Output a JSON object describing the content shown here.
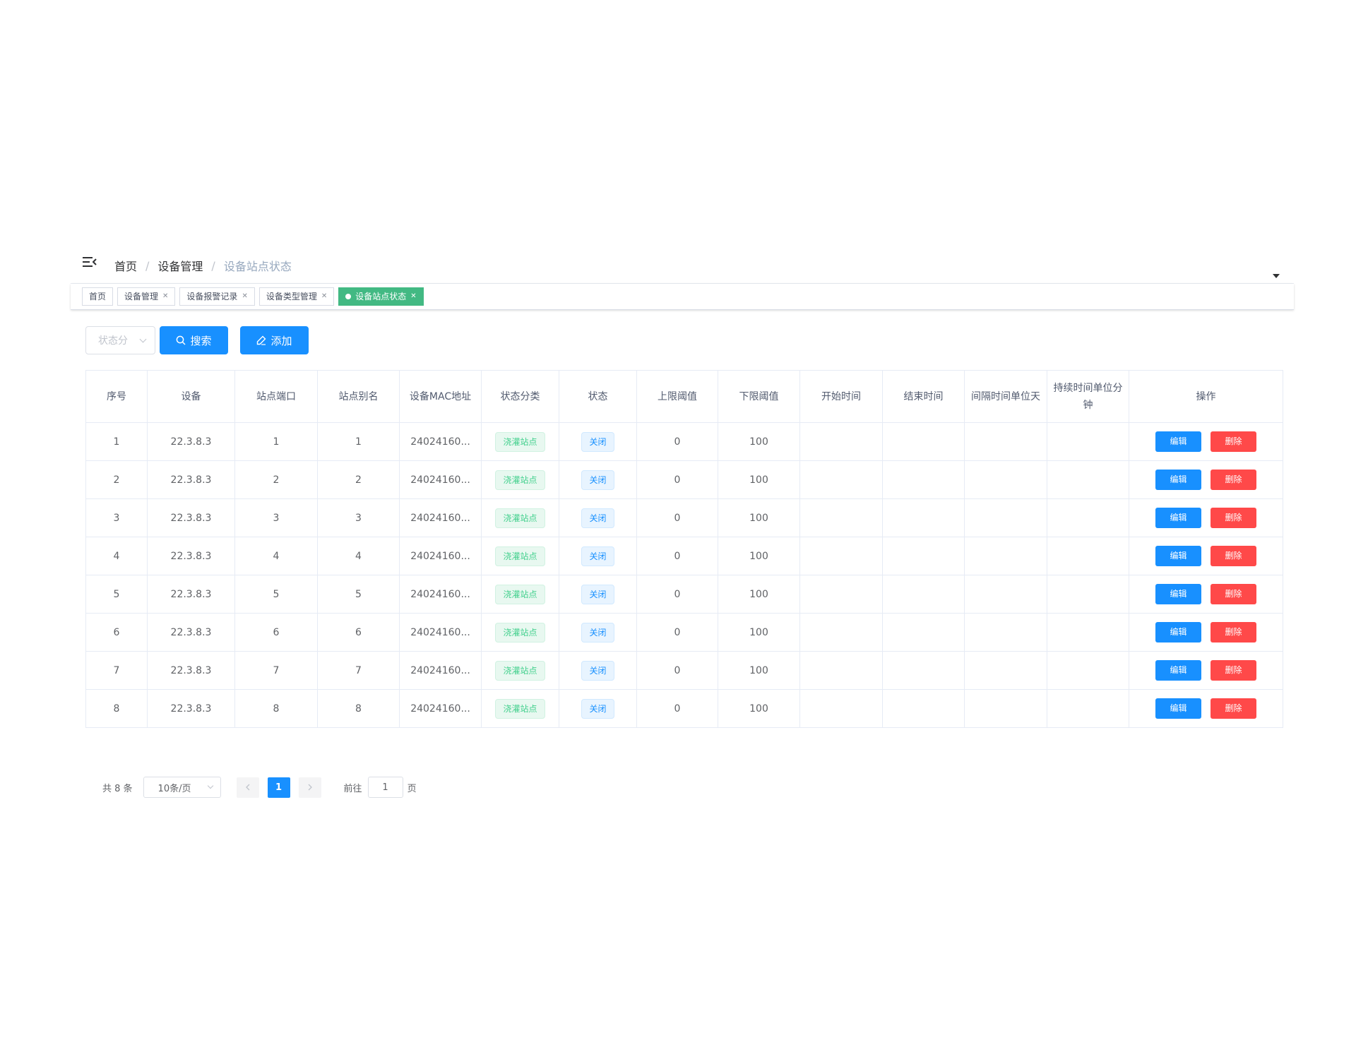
{
  "breadcrumb": [
    "首页",
    "设备管理",
    "设备站点状态"
  ],
  "tags": [
    {
      "label": "首页",
      "closable": false,
      "active": false
    },
    {
      "label": "设备管理",
      "closable": true,
      "active": false
    },
    {
      "label": "设备报警记录",
      "closable": true,
      "active": false
    },
    {
      "label": "设备类型管理",
      "closable": true,
      "active": false
    },
    {
      "label": "设备站点状态",
      "closable": true,
      "active": true
    }
  ],
  "toolbar": {
    "status_placeholder": "状态分",
    "search_label": "搜索",
    "add_label": "添加"
  },
  "table": {
    "columns": [
      "序号",
      "设备",
      "站点端口",
      "站点别名",
      "设备MAC地址",
      "状态分类",
      "状态",
      "上限阈值",
      "下限阈值",
      "开始时间",
      "结束时间",
      "间隔时间单位天",
      "持续时间单位分钟",
      "操作"
    ],
    "rows": [
      {
        "index": "1",
        "device": "22.3.8.3",
        "port": "1",
        "alias": "1",
        "mac": "24024160...",
        "category": "浇灌站点",
        "status": "关闭",
        "upper": "0",
        "lower": "100",
        "start": "",
        "end": "",
        "interval": "",
        "duration": ""
      },
      {
        "index": "2",
        "device": "22.3.8.3",
        "port": "2",
        "alias": "2",
        "mac": "24024160...",
        "category": "浇灌站点",
        "status": "关闭",
        "upper": "0",
        "lower": "100",
        "start": "",
        "end": "",
        "interval": "",
        "duration": ""
      },
      {
        "index": "3",
        "device": "22.3.8.3",
        "port": "3",
        "alias": "3",
        "mac": "24024160...",
        "category": "浇灌站点",
        "status": "关闭",
        "upper": "0",
        "lower": "100",
        "start": "",
        "end": "",
        "interval": "",
        "duration": ""
      },
      {
        "index": "4",
        "device": "22.3.8.3",
        "port": "4",
        "alias": "4",
        "mac": "24024160...",
        "category": "浇灌站点",
        "status": "关闭",
        "upper": "0",
        "lower": "100",
        "start": "",
        "end": "",
        "interval": "",
        "duration": ""
      },
      {
        "index": "5",
        "device": "22.3.8.3",
        "port": "5",
        "alias": "5",
        "mac": "24024160...",
        "category": "浇灌站点",
        "status": "关闭",
        "upper": "0",
        "lower": "100",
        "start": "",
        "end": "",
        "interval": "",
        "duration": ""
      },
      {
        "index": "6",
        "device": "22.3.8.3",
        "port": "6",
        "alias": "6",
        "mac": "24024160...",
        "category": "浇灌站点",
        "status": "关闭",
        "upper": "0",
        "lower": "100",
        "start": "",
        "end": "",
        "interval": "",
        "duration": ""
      },
      {
        "index": "7",
        "device": "22.3.8.3",
        "port": "7",
        "alias": "7",
        "mac": "24024160...",
        "category": "浇灌站点",
        "status": "关闭",
        "upper": "0",
        "lower": "100",
        "start": "",
        "end": "",
        "interval": "",
        "duration": ""
      },
      {
        "index": "8",
        "device": "22.3.8.3",
        "port": "8",
        "alias": "8",
        "mac": "24024160...",
        "category": "浇灌站点",
        "status": "关闭",
        "upper": "0",
        "lower": "100",
        "start": "",
        "end": "",
        "interval": "",
        "duration": ""
      }
    ],
    "edit_label": "编辑",
    "delete_label": "删除"
  },
  "pagination": {
    "total_text": "共 8 条",
    "page_size": "10条/页",
    "current_page": "1",
    "goto_label": "前往",
    "goto_value": "1",
    "goto_unit": "页"
  },
  "colors": {
    "primary": "#1890ff",
    "danger": "#ff4949",
    "tag_active": "#42b983",
    "success_text": "#42d08d"
  },
  "icons": {
    "menu": "hamburger-icon",
    "search": "search-icon",
    "add": "edit-icon",
    "prev": "chevron-left-icon",
    "next": "chevron-right-icon",
    "dropdown": "caret-down-icon"
  }
}
